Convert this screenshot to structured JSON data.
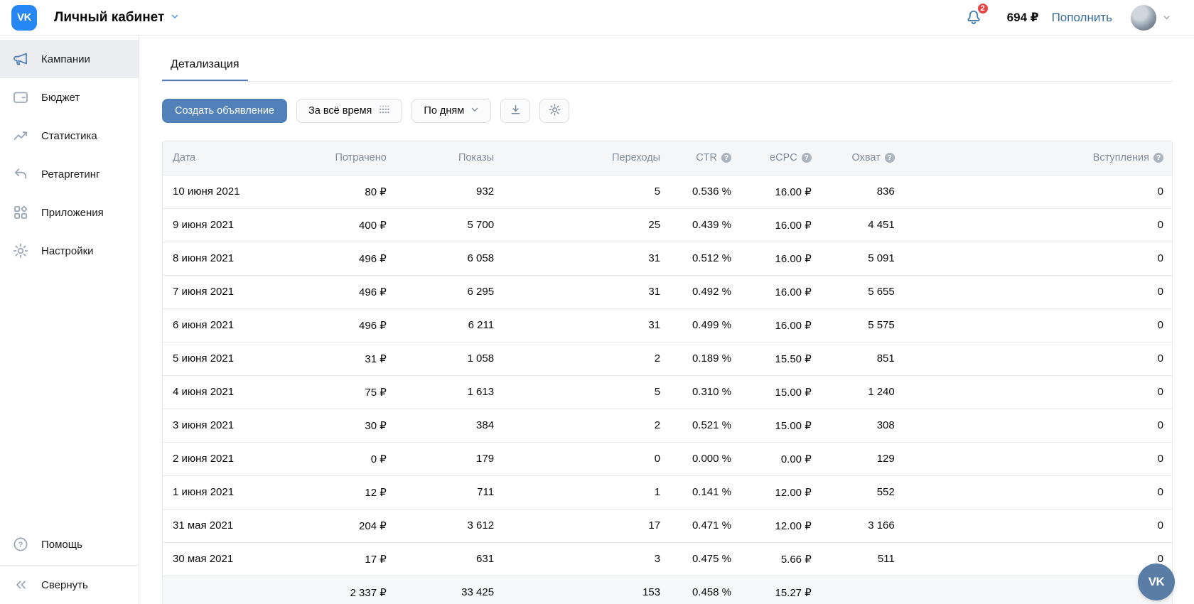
{
  "topbar": {
    "logo_text": "VK",
    "title": "Личный кабинет",
    "notifications_count": "2",
    "balance": "694 ₽",
    "topup_label": "Пополнить"
  },
  "sidebar": {
    "items": [
      {
        "label": "Кампании",
        "icon": "megaphone-icon",
        "active": true
      },
      {
        "label": "Бюджет",
        "icon": "wallet-icon",
        "active": false
      },
      {
        "label": "Статистика",
        "icon": "stats-icon",
        "active": false
      },
      {
        "label": "Ретаргетинг",
        "icon": "retargeting-icon",
        "active": false
      },
      {
        "label": "Приложения",
        "icon": "apps-icon",
        "active": false
      },
      {
        "label": "Настройки",
        "icon": "gear-icon",
        "active": false
      }
    ],
    "help_label": "Помощь",
    "collapse_label": "Свернуть"
  },
  "tabs": [
    {
      "label": "Детализация",
      "active": true
    }
  ],
  "toolbar": {
    "create_button": "Создать объявление",
    "period_button": "За всё время",
    "grouping_button": "По дням"
  },
  "table": {
    "columns": [
      {
        "label": "Дата",
        "help": false
      },
      {
        "label": "Потрачено",
        "help": false
      },
      {
        "label": "Показы",
        "help": false
      },
      {
        "label": "Переходы",
        "help": false
      },
      {
        "label": "CTR",
        "help": true
      },
      {
        "label": "eCPC",
        "help": true
      },
      {
        "label": "Охват",
        "help": true
      },
      {
        "label": "Вступления",
        "help": true
      }
    ],
    "rows": [
      [
        "10 июня 2021",
        "80 ₽",
        "932",
        "5",
        "0.536 %",
        "16.00 ₽",
        "836",
        "0"
      ],
      [
        "9 июня 2021",
        "400 ₽",
        "5 700",
        "25",
        "0.439 %",
        "16.00 ₽",
        "4 451",
        "0"
      ],
      [
        "8 июня 2021",
        "496 ₽",
        "6 058",
        "31",
        "0.512 %",
        "16.00 ₽",
        "5 091",
        "0"
      ],
      [
        "7 июня 2021",
        "496 ₽",
        "6 295",
        "31",
        "0.492 %",
        "16.00 ₽",
        "5 655",
        "0"
      ],
      [
        "6 июня 2021",
        "496 ₽",
        "6 211",
        "31",
        "0.499 %",
        "16.00 ₽",
        "5 575",
        "0"
      ],
      [
        "5 июня 2021",
        "31 ₽",
        "1 058",
        "2",
        "0.189 %",
        "15.50 ₽",
        "851",
        "0"
      ],
      [
        "4 июня 2021",
        "75 ₽",
        "1 613",
        "5",
        "0.310 %",
        "15.00 ₽",
        "1 240",
        "0"
      ],
      [
        "3 июня 2021",
        "30 ₽",
        "384",
        "2",
        "0.521 %",
        "15.00 ₽",
        "308",
        "0"
      ],
      [
        "2 июня 2021",
        "0 ₽",
        "179",
        "0",
        "0.000 %",
        "0.00 ₽",
        "129",
        "0"
      ],
      [
        "1 июня 2021",
        "12 ₽",
        "711",
        "1",
        "0.141 %",
        "12.00 ₽",
        "552",
        "0"
      ],
      [
        "31 мая 2021",
        "204 ₽",
        "3 612",
        "17",
        "0.471 %",
        "12.00 ₽",
        "3 166",
        "0"
      ],
      [
        "30 мая 2021",
        "17 ₽",
        "631",
        "3",
        "0.475 %",
        "5.66 ₽",
        "511",
        "0"
      ]
    ],
    "totals": [
      "",
      "2 337 ₽",
      "33 425",
      "153",
      "0.458 %",
      "15.27 ₽",
      "",
      ""
    ]
  },
  "fab": {
    "label": "VK"
  },
  "colors": {
    "accent": "#5181b8",
    "brand": "#2787f5",
    "link": "#3a6d9e",
    "badge": "#e64646",
    "fab": "#5a7da5",
    "header_text": "#818c99",
    "border": "#e7e8ec"
  }
}
